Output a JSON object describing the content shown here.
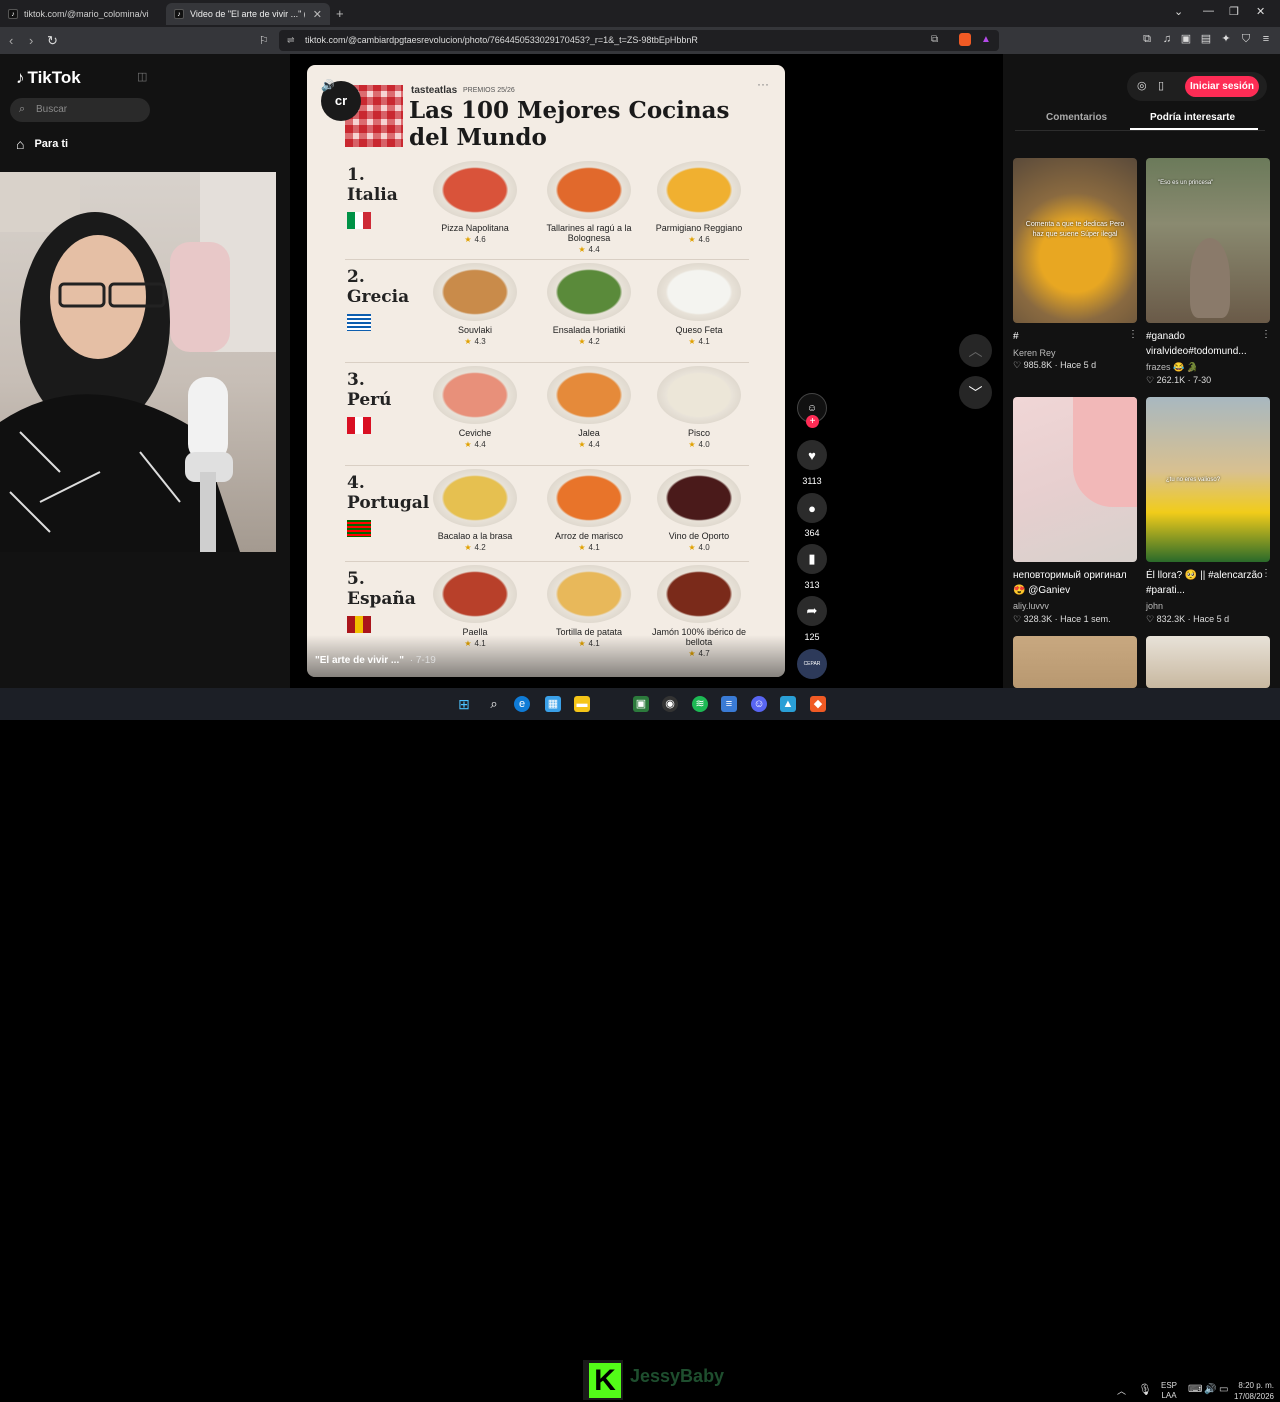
{
  "browser": {
    "tabs": [
      {
        "title": "tiktok.com/@mario_colomina/video/"
      },
      {
        "title": "Video de \"El arte de vivir ...\" (@c"
      }
    ],
    "url": "tiktok.com/@cambiardpgtaesrevolucion/photo/7664450533029170453?_r=1&_t=ZS-98tbEpHbbnR"
  },
  "tiktok": {
    "logo": "TikTok",
    "search_placeholder": "Buscar",
    "nav_para_ti": "Para ti",
    "login_button": "Iniciar sesión",
    "tabs": {
      "comments": "Comentarios",
      "suggested": "Podría interesarte"
    }
  },
  "post": {
    "brand": "tasteatlas",
    "premios": "PREMIOS 25/26",
    "title_line1": "Las 100 Mejores Cocinas",
    "title_line2": "del Mundo",
    "avatar_label": "cr",
    "caption": "\"El arte de vivir ...\"",
    "caption_date": "· 7-19",
    "countries": [
      {
        "rank": "1.",
        "name": "Italia",
        "flag_colors": [
          "#009246",
          "#ffffff",
          "#ce2b37"
        ],
        "dishes": [
          {
            "name": "Pizza Napolitana",
            "rating": "4.6"
          },
          {
            "name": "Tallarines al ragú a la Bolognesa",
            "rating": "4.4"
          },
          {
            "name": "Parmigiano Reggiano",
            "rating": "4.6"
          }
        ]
      },
      {
        "rank": "2.",
        "name": "Grecia",
        "flag_colors": [
          "#0d5eaf",
          "#ffffff"
        ],
        "dishes": [
          {
            "name": "Souvlaki",
            "rating": "4.3"
          },
          {
            "name": "Ensalada Horiatiki",
            "rating": "4.2"
          },
          {
            "name": "Queso Feta",
            "rating": "4.1"
          }
        ]
      },
      {
        "rank": "3.",
        "name": "Perú",
        "flag_colors": [
          "#d91023",
          "#ffffff",
          "#d91023"
        ],
        "dishes": [
          {
            "name": "Ceviche",
            "rating": "4.4"
          },
          {
            "name": "Jalea",
            "rating": "4.4"
          },
          {
            "name": "Pisco",
            "rating": "4.0"
          }
        ]
      },
      {
        "rank": "4.",
        "name": "Portugal",
        "flag_colors": [
          "#006600",
          "#ff0000"
        ],
        "dishes": [
          {
            "name": "Bacalao a la brasa",
            "rating": "4.2"
          },
          {
            "name": "Arroz de marisco",
            "rating": "4.1"
          },
          {
            "name": "Vino de Oporto",
            "rating": "4.0"
          }
        ]
      },
      {
        "rank": "5.",
        "name": "España",
        "flag_colors": [
          "#aa151b",
          "#f1bf00",
          "#aa151b"
        ],
        "dishes": [
          {
            "name": "Paella",
            "rating": "4.1"
          },
          {
            "name": "Tortilla de patata",
            "rating": "4.1"
          },
          {
            "name": "Jamón 100% ibérico de bellota",
            "rating": "4.7"
          }
        ]
      }
    ],
    "actions": {
      "likes": "3113",
      "comments": "364",
      "saves": "313",
      "shares": "125",
      "sound_label": "CEPAR"
    }
  },
  "suggested": [
    {
      "title": "#",
      "author": "Keren Rey",
      "views": "985.8K",
      "date": "Hace 5 d",
      "overlay": "Comenta a que te dedicas Pero haz que suene Súper ilegal"
    },
    {
      "title": "#ganado viralvideo#todomund...",
      "author": "frazes 😂 🐊",
      "views": "262.1K",
      "date": "7-30",
      "overlay": "\"Eso es un princesa\""
    },
    {
      "title": "неповторимый оригинал 😍 @Ganiev",
      "author": "aliy.luvvv",
      "views": "328.3K",
      "date": "Hace 1 sem.",
      "overlay": ""
    },
    {
      "title": "Él llora? 🥺 || #alencarzão #parati...",
      "author": "john",
      "views": "832.3K",
      "date": "Hace 5 d",
      "overlay": "¿tu no eres valioso?"
    }
  ],
  "taskbar": {
    "stream_name": "JessyBaby",
    "lang": "ESP",
    "lang_sub": "LAA",
    "time": "8:20 p. m.",
    "date": "17/08/2026"
  }
}
